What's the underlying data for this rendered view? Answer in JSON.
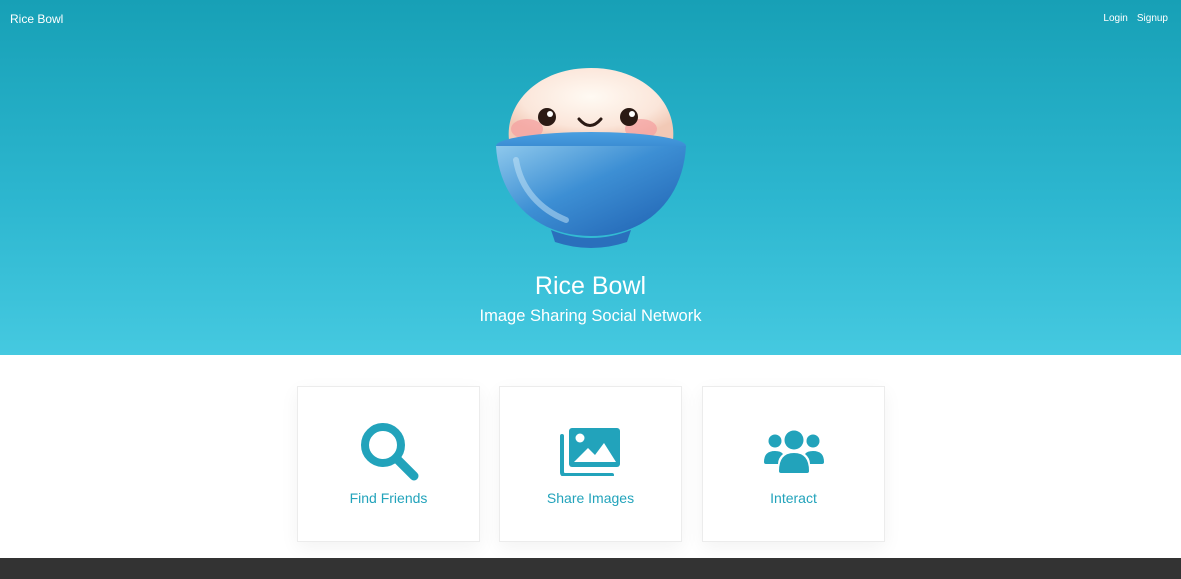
{
  "navbar": {
    "brand": "Rice Bowl",
    "links": [
      "Login",
      "Signup"
    ]
  },
  "hero": {
    "title": "Rice Bowl",
    "subtitle": "Image Sharing Social Network",
    "mascot_icon": "rice-bowl-mascot"
  },
  "features": [
    {
      "label": "Find Friends",
      "icon": "search-icon"
    },
    {
      "label": "Share Images",
      "icon": "images-icon"
    },
    {
      "label": "Interact",
      "icon": "users-icon"
    }
  ],
  "colors": {
    "hero_top": "#17a0b6",
    "hero_bottom": "#45c9e0",
    "accent": "#22a3bb",
    "footer": "#333333"
  }
}
